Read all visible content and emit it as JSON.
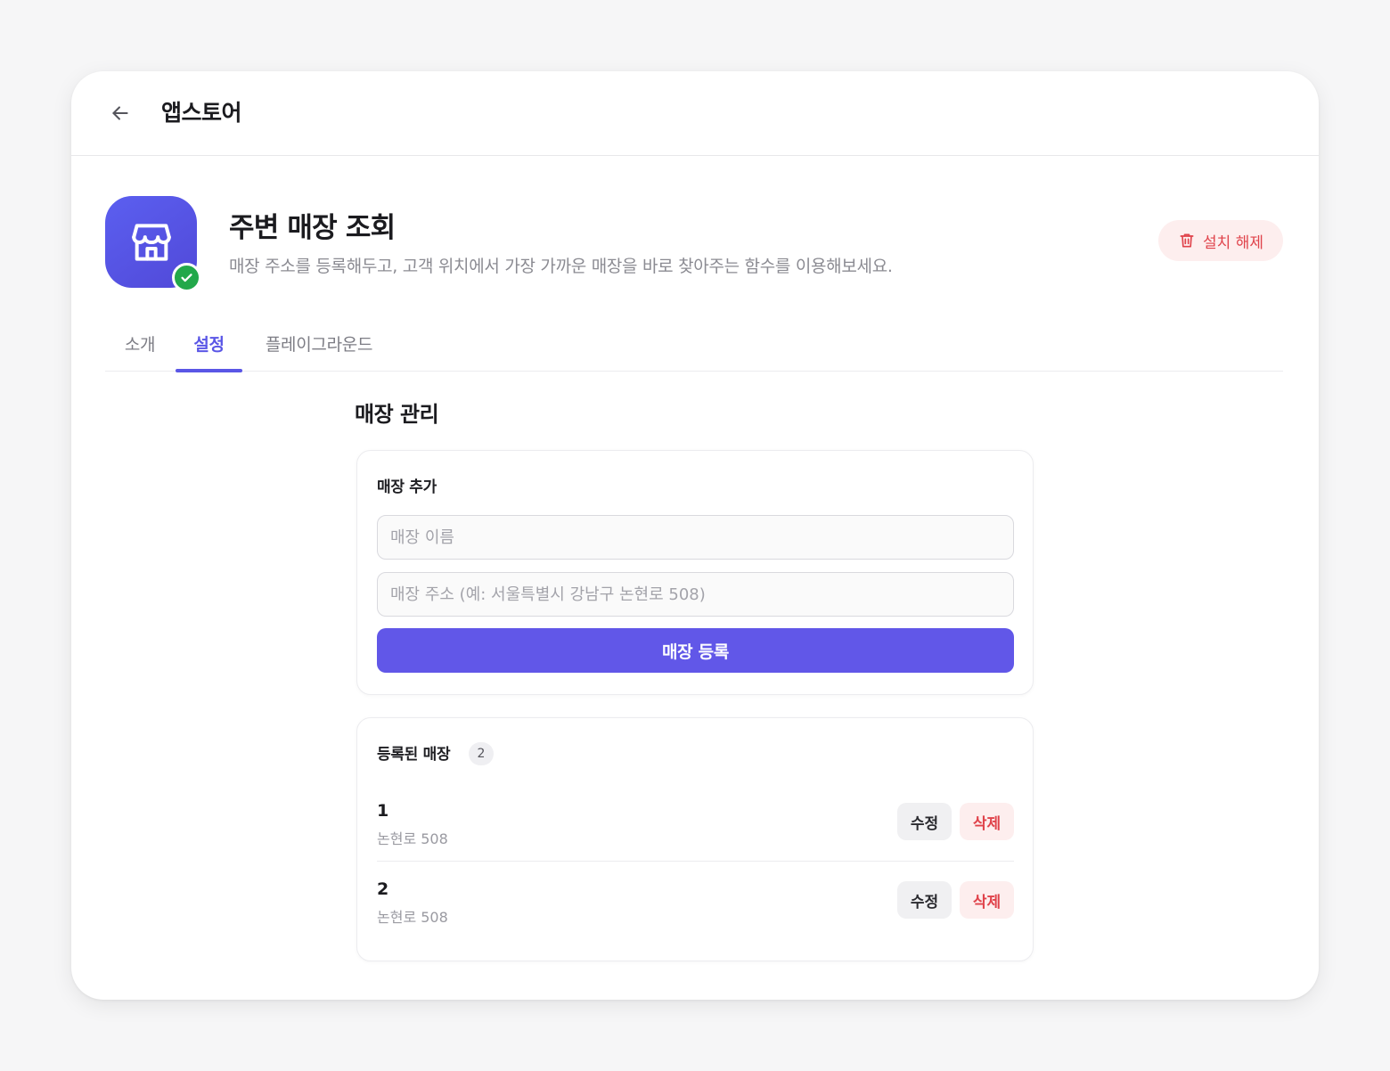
{
  "header": {
    "title": "앱스토어",
    "back_icon": "arrow-left-icon"
  },
  "app": {
    "title": "주변 매장 조회",
    "description": "매장 주소를 등록해두고, 고객 위치에서 가장 가까운 매장을 바로 찾아주는 함수를 이용해보세요.",
    "icon": "store-icon",
    "installed_icon": "check-icon",
    "icon_color": "#5b5ff0",
    "uninstall_label": "설치 해제",
    "uninstall_icon": "trash-icon"
  },
  "tabs": [
    {
      "label": "소개",
      "active": false
    },
    {
      "label": "설정",
      "active": true
    },
    {
      "label": "플레이그라운드",
      "active": false
    }
  ],
  "settings": {
    "section_title": "매장 관리",
    "add_card": {
      "heading": "매장 추가",
      "name_placeholder": "매장 이름",
      "name_value": "",
      "address_placeholder": "매장 주소 (예: 서울특별시 강남구 논현로 508)",
      "address_value": "",
      "submit_label": "매장 등록"
    },
    "list_card": {
      "heading": "등록된 매장",
      "count": "2",
      "stores": [
        {
          "name": "1",
          "address": "논현로 508",
          "edit_label": "수정",
          "delete_label": "삭제"
        },
        {
          "name": "2",
          "address": "논현로 508",
          "edit_label": "수정",
          "delete_label": "삭제"
        }
      ]
    }
  },
  "colors": {
    "accent": "#6157e8",
    "danger": "#e0434b",
    "danger_bg": "#fdeeee",
    "success": "#22a84a"
  }
}
